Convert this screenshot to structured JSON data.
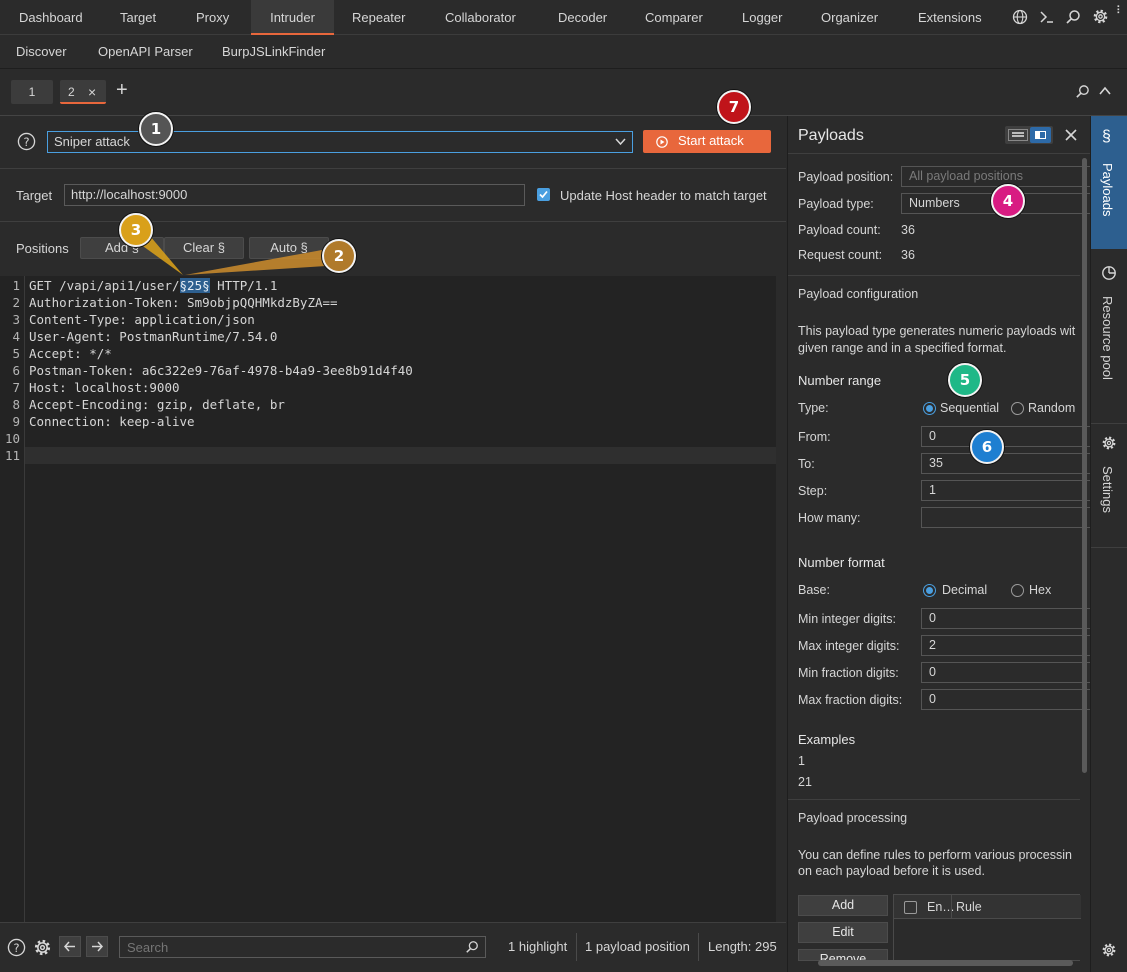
{
  "nav": {
    "tabs": [
      "Dashboard",
      "Target",
      "Proxy",
      "Intruder",
      "Repeater",
      "Collaborator",
      "Decoder",
      "Comparer",
      "Logger",
      "Organizer",
      "Extensions"
    ],
    "active": "Intruder",
    "subtabs": [
      "Discover",
      "OpenAPI Parser",
      "BurpJSLinkFinder"
    ]
  },
  "instances": {
    "tab1": "1",
    "tab2": "2",
    "close": "×",
    "add": "+"
  },
  "attack": {
    "type": "Sniper attack",
    "start_label": "Start attack"
  },
  "target": {
    "label": "Target",
    "url": "http://localhost:9000",
    "update_host_label": "Update Host header to match target",
    "update_host_checked": true
  },
  "positions": {
    "label": "Positions",
    "add": "Add §",
    "clear": "Clear §",
    "auto": "Auto §"
  },
  "request": {
    "lines": [
      {
        "num": "1",
        "pre": "GET /vapi/api1/user/",
        "marker": "§25§",
        "post": " HTTP/1.1"
      },
      {
        "num": "2",
        "pre": "Authorization-Token: Sm9objpQQHMkdzByZA==",
        "marker": "",
        "post": ""
      },
      {
        "num": "3",
        "pre": "Content-Type: application/json",
        "marker": "",
        "post": ""
      },
      {
        "num": "4",
        "pre": "User-Agent: PostmanRuntime/7.54.0",
        "marker": "",
        "post": ""
      },
      {
        "num": "5",
        "pre": "Accept: */*",
        "marker": "",
        "post": ""
      },
      {
        "num": "6",
        "pre": "Postman-Token: a6c322e9-76af-4978-b4a9-3ee8b91d4f40",
        "marker": "",
        "post": ""
      },
      {
        "num": "7",
        "pre": "Host: localhost:9000",
        "marker": "",
        "post": ""
      },
      {
        "num": "8",
        "pre": "Accept-Encoding: gzip, deflate, br",
        "marker": "",
        "post": ""
      },
      {
        "num": "9",
        "pre": "Connection: keep-alive",
        "marker": "",
        "post": ""
      },
      {
        "num": "10",
        "pre": "",
        "marker": "",
        "post": ""
      },
      {
        "num": "11",
        "pre": "",
        "marker": "",
        "post": ""
      }
    ]
  },
  "statusbar": {
    "search_placeholder": "Search",
    "highlights": "1 highlight",
    "positions": "1 payload position",
    "length": "Length: 295"
  },
  "payloads": {
    "title": "Payloads",
    "position_label": "Payload position:",
    "position_value": "All payload positions",
    "type_label": "Payload type:",
    "type_value": "Numbers",
    "count_label": "Payload count:",
    "count_value": "36",
    "request_label": "Request count:",
    "request_value": "36",
    "config_heading": "Payload configuration",
    "config_desc1": "This payload type generates numeric payloads wit",
    "config_desc2": "given range and in a specified format.",
    "range_heading": "Number range",
    "type_row_label": "Type:",
    "sequential": "Sequential",
    "random": "Random",
    "from_label": "From:",
    "from_value": "0",
    "to_label": "To:",
    "to_value": "35",
    "step_label": "Step:",
    "step_value": "1",
    "howmany_label": "How many:",
    "howmany_value": "",
    "format_heading": "Number format",
    "base_label": "Base:",
    "decimal": "Decimal",
    "hex": "Hex",
    "minint_label": "Min integer digits:",
    "minint_value": "0",
    "maxint_label": "Max integer digits:",
    "maxint_value": "2",
    "minfrac_label": "Min fraction digits:",
    "minfrac_value": "0",
    "maxfrac_label": "Max fraction digits:",
    "maxfrac_value": "0",
    "examples_heading": "Examples",
    "example1": "1",
    "example2": "21",
    "processing_heading": "Payload processing",
    "processing_desc1": "You can define rules to perform various processin",
    "processing_desc2": "on each payload before it is used.",
    "add_btn": "Add",
    "edit_btn": "Edit",
    "remove_btn": "Remove",
    "col_enabled": "En…",
    "col_rule": "Rule"
  },
  "sidebar": {
    "payloads": "Payloads",
    "resource_pool": "Resource pool",
    "settings": "Settings"
  },
  "callouts": [
    "1",
    "2",
    "3",
    "4",
    "5",
    "6",
    "7"
  ],
  "colors": {
    "accent": "#e8673c",
    "selection": "#2d5f8f",
    "radio": "#4a9fe0"
  }
}
